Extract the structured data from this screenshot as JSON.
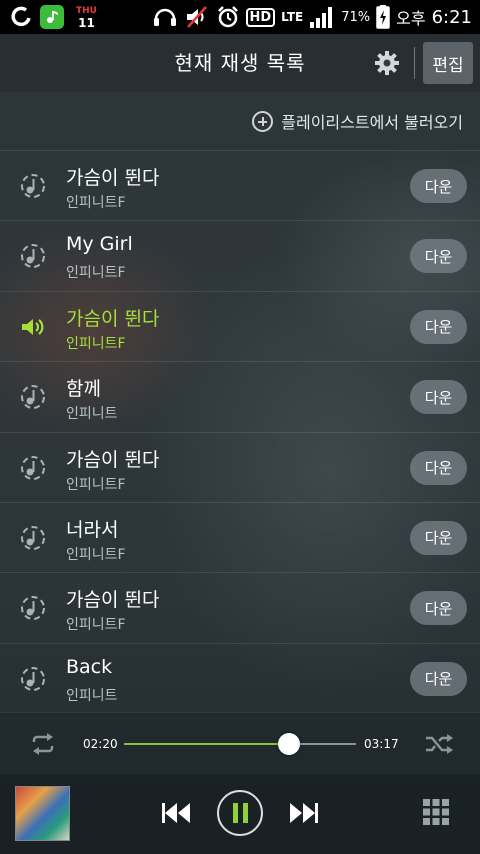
{
  "status_bar": {
    "day": "THU",
    "date": "11",
    "network": "LTE",
    "hd": "HD",
    "battery": "71%",
    "ampm": "오후",
    "time": "6:21"
  },
  "header": {
    "title": "현재 재생 목록",
    "edit_label": "편집"
  },
  "load_playlist_label": "플레이리스트에서 불러오기",
  "download_label": "다운",
  "songs": [
    {
      "title": "가슴이 뛴다",
      "artist": "인피니트F",
      "active": false
    },
    {
      "title": "My Girl",
      "artist": "인피니트F",
      "active": false
    },
    {
      "title": "가슴이 뛴다",
      "artist": "인피니트F",
      "active": true
    },
    {
      "title": "함께",
      "artist": "인피니트",
      "active": false
    },
    {
      "title": "가슴이 뛴다",
      "artist": "인피니트F",
      "active": false
    },
    {
      "title": "너라서",
      "artist": "인피니트F",
      "active": false
    },
    {
      "title": "가슴이 뛴다",
      "artist": "인피니트F",
      "active": false
    },
    {
      "title": "Back",
      "artist": "인피니트",
      "active": false
    }
  ],
  "player": {
    "current_time": "02:20",
    "total_time": "03:17",
    "progress": 0.71
  },
  "colors": {
    "accent": "#a6df36",
    "play_accent": "#8fd13a",
    "progress_fill": "#86c23d"
  }
}
